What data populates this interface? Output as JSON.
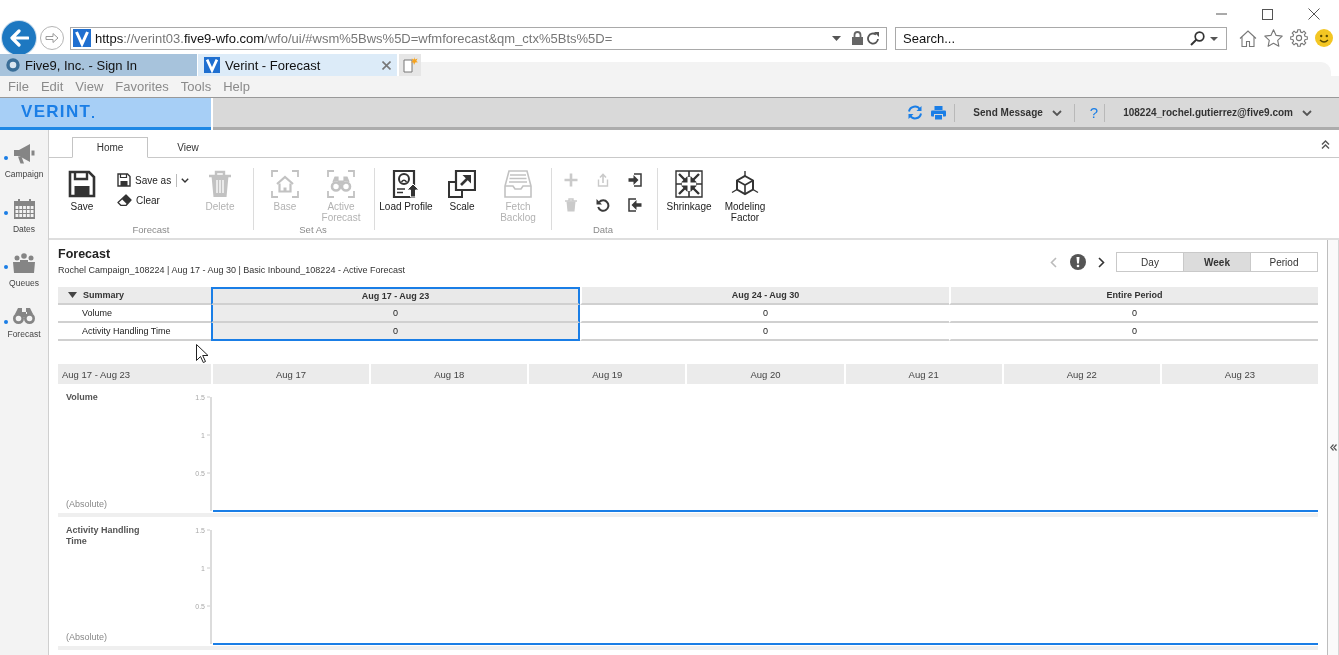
{
  "browser": {
    "url": [
      {
        "text": "https",
        "emphasized": true
      },
      {
        "text": "://verint03.",
        "emphasized": false
      },
      {
        "text": "five9-wfo.com",
        "emphasized": true
      },
      {
        "text": "/wfo/ui/#wsm%5Bws%5D=wfmforecast&qm_ctx%5Bts%5D=",
        "emphasized": false
      }
    ],
    "search": {
      "placeholder": "Search..."
    },
    "tabs": [
      {
        "label": "Five9, Inc. - Sign In",
        "selected": false
      },
      {
        "label": "Verint - Forecast",
        "selected": true
      }
    ],
    "menu": [
      "File",
      "Edit",
      "View",
      "Favorites",
      "Tools",
      "Help"
    ]
  },
  "app_header": {
    "logo": "VERINT",
    "send_message": "Send Message",
    "help": "?",
    "user": "108224_rochel.gutierrez@five9.com"
  },
  "nav_rail": [
    {
      "label": "Campaign"
    },
    {
      "label": "Dates"
    },
    {
      "label": "Queues"
    },
    {
      "label": "Forecast"
    }
  ],
  "ribbon": {
    "tabs": [
      {
        "label": "Home",
        "selected": true
      },
      {
        "label": "View",
        "selected": false
      }
    ],
    "groups": [
      {
        "label": "Forecast",
        "items": [
          {
            "kind": "large",
            "label": "Save",
            "disabled": false
          },
          {
            "kind": "stack",
            "buttons": [
              {
                "label": "Save as",
                "menu": true
              },
              {
                "label": "Clear",
                "menu": false
              }
            ]
          },
          {
            "kind": "large",
            "label": "Delete",
            "disabled": true
          }
        ]
      },
      {
        "label": "Set As",
        "items": [
          {
            "kind": "large",
            "label": "Base",
            "disabled": true
          },
          {
            "kind": "large",
            "label": "Active Forecast",
            "disabled": true
          }
        ]
      },
      {
        "items": [
          {
            "kind": "large",
            "label": "Load Profile",
            "disabled": false
          },
          {
            "kind": "large",
            "label": "Scale",
            "disabled": false
          },
          {
            "kind": "large",
            "label": "Fetch Backlog",
            "disabled": true
          }
        ]
      },
      {
        "label": "Data",
        "items": [
          {
            "kind": "grid",
            "buttons": [
              {
                "disabled": true
              },
              {
                "disabled": true
              },
              {
                "disabled": false
              },
              {
                "disabled": true
              },
              {
                "disabled": false
              },
              {
                "disabled": false
              }
            ]
          }
        ]
      },
      {
        "items": [
          {
            "kind": "large",
            "label": "Shrinkage",
            "disabled": false
          },
          {
            "kind": "large",
            "label": "Modeling Factor",
            "disabled": false
          }
        ]
      }
    ]
  },
  "forecast": {
    "title": "Forecast",
    "subtitle": "Rochel Campaign_108224 | Aug 17 - Aug 30 | Basic Inbound_108224 - Active Forecast"
  },
  "pager": {
    "previous": {
      "disabled": true
    },
    "next": {
      "disabled": false
    }
  },
  "view_modes": [
    {
      "label": "Day",
      "selected": false
    },
    {
      "label": "Week",
      "selected": true
    },
    {
      "label": "Period",
      "selected": false
    }
  ],
  "summary": {
    "title": "Summary",
    "expanded": true,
    "columns": [
      {
        "label": "Aug 17 - Aug 23",
        "selected": true
      },
      {
        "label": "Aug 24 - Aug 30",
        "selected": false
      },
      {
        "label": "Entire Period",
        "selected": false
      }
    ],
    "rows": [
      {
        "label": "Volume",
        "values": [
          "0",
          "0",
          "0"
        ]
      },
      {
        "label": "Activity Handling Time",
        "values": [
          "0",
          "0",
          "0"
        ]
      }
    ]
  },
  "daily_header": {
    "range": "Aug 17 - Aug 23",
    "days": [
      "Aug 17",
      "Aug 18",
      "Aug 19",
      "Aug 20",
      "Aug 21",
      "Aug 22",
      "Aug 23"
    ]
  },
  "charts": [
    {
      "title": "Volume",
      "unit": "(Absolute)",
      "y_ticks": [
        "1.5",
        "1",
        "0.5"
      ]
    },
    {
      "title": "Activity Handling Time",
      "unit": "(Absolute)",
      "y_ticks": [
        "1.5",
        "1",
        "0.5"
      ]
    }
  ]
}
